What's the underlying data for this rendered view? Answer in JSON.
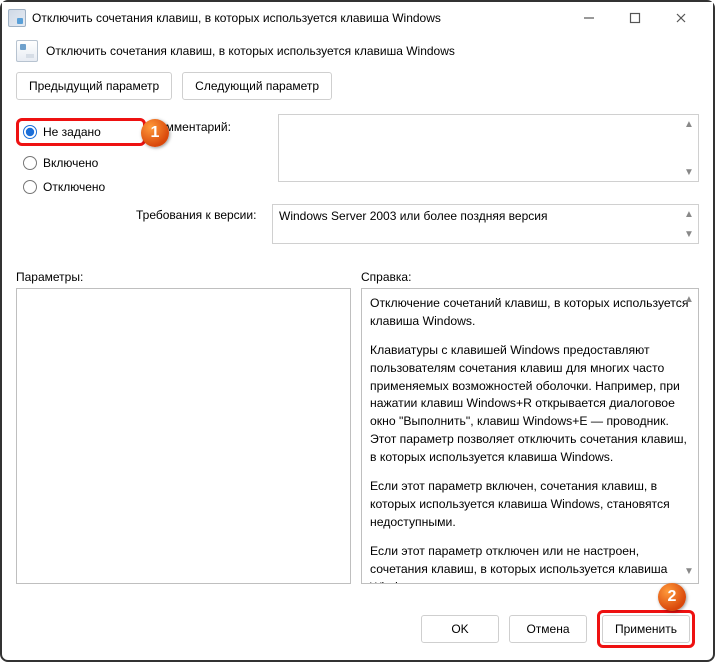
{
  "window": {
    "title": "Отключить сочетания клавиш, в которых используется клавиша Windows"
  },
  "header": {
    "description": "Отключить сочетания клавиш, в которых используется клавиша Windows"
  },
  "nav": {
    "prev": "Предыдущий параметр",
    "next": "Следующий параметр"
  },
  "state": {
    "not_configured": "Не задано",
    "enabled": "Включено",
    "disabled": "Отключено",
    "selected": "not_configured"
  },
  "labels": {
    "comment": "Комментарий:",
    "requirements": "Требования к версии:",
    "parameters": "Параметры:",
    "help": "Справка:"
  },
  "comment_text": "",
  "requirements_text": "Windows Server 2003 или более поздняя версия",
  "help": {
    "p1": "Отключение сочетаний клавиш, в которых используется клавиша Windows.",
    "p2": "Клавиатуры с клавишей Windows предоставляют пользователям сочетания клавиш для многих часто применяемых возможностей оболочки. Например, при нажатии клавиш Windows+R открывается диалоговое окно \"Выполнить\", клавиш Windows+E — проводник. Этот параметр позволяет отключить сочетания клавиш, в которых используется клавиша Windows.",
    "p3": "Если этот параметр включен, сочетания клавиш, в которых используется клавиша Windows, становятся недоступными.",
    "p4": "Если этот параметр отключен или не настроен, сочетания клавиш, в которых используется клавиша Windows, доступны."
  },
  "footer": {
    "ok": "OK",
    "cancel": "Отмена",
    "apply": "Применить"
  },
  "annotations": {
    "marker1": "1",
    "marker2": "2"
  }
}
